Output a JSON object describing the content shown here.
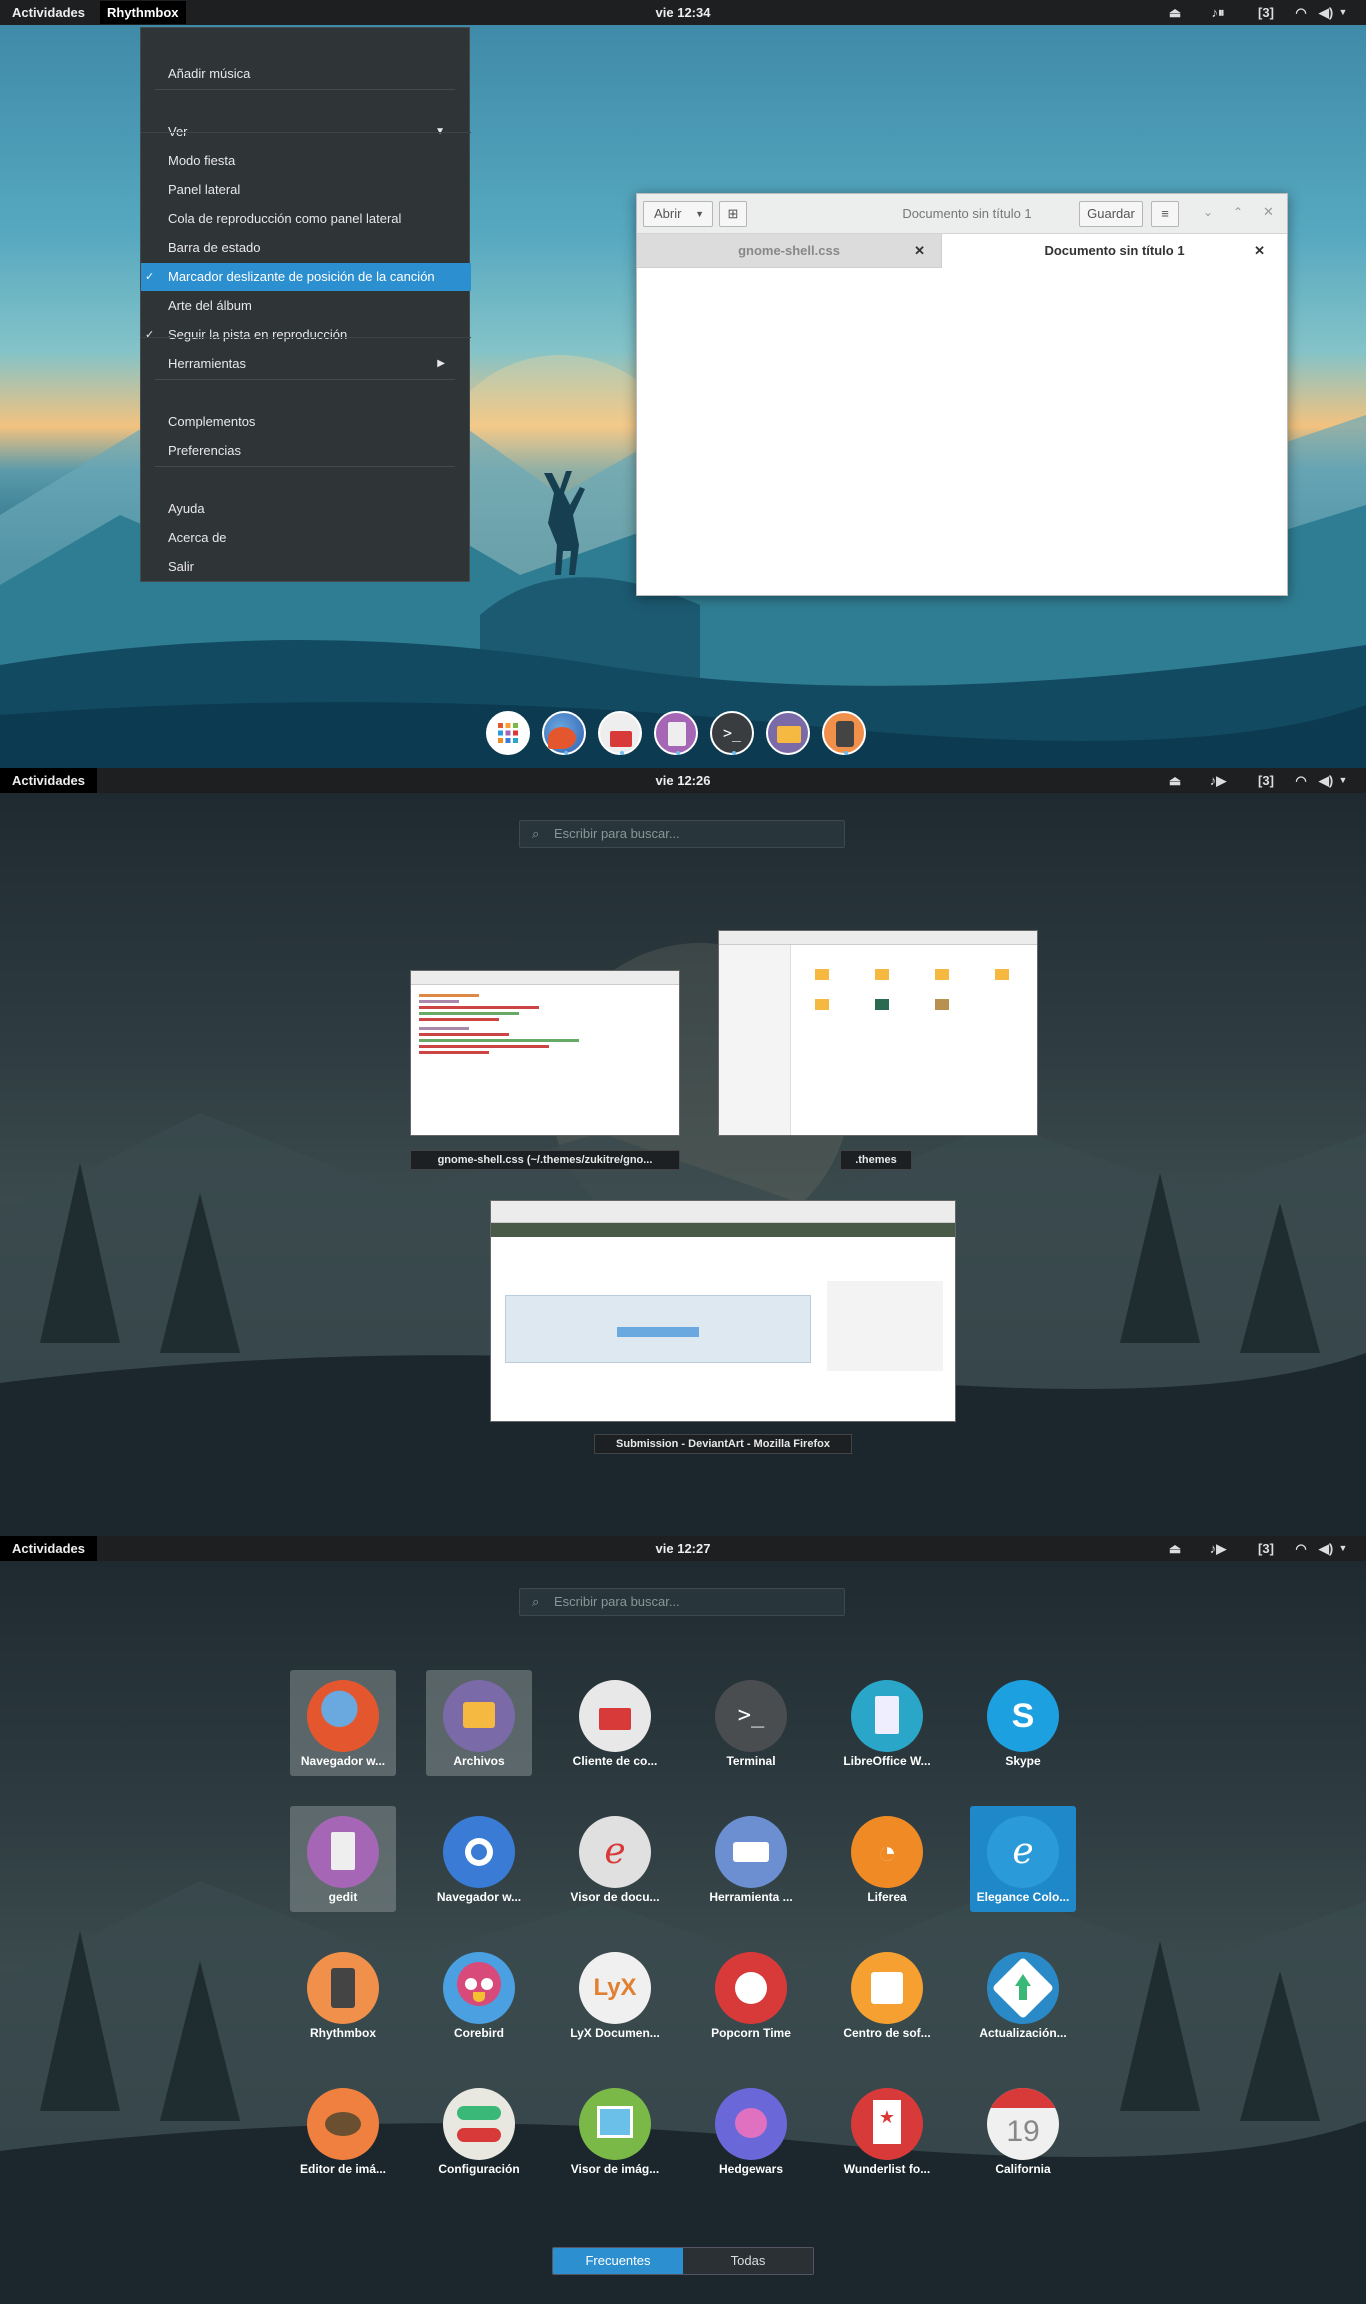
{
  "screen1": {
    "topbar": {
      "activities": "Actividades",
      "app_menu": "Rhythmbox",
      "clock": "vie 12:34",
      "workspace": "[3]"
    },
    "menu": {
      "items": [
        {
          "label": "Añadir música"
        },
        {
          "label": "Ver"
        },
        {
          "label": "Modo fiesta"
        },
        {
          "label": "Panel lateral"
        },
        {
          "label": "Cola de reproducción como panel lateral"
        },
        {
          "label": "Barra de estado"
        },
        {
          "label": "Marcador deslizante de posición de la canción",
          "checked": true,
          "selected": true
        },
        {
          "label": "Arte del álbum"
        },
        {
          "label": "Seguir la pista en reproducción",
          "checked": true
        },
        {
          "label": "Herramientas"
        },
        {
          "label": "Complementos"
        },
        {
          "label": "Preferencias"
        },
        {
          "label": "Ayuda"
        },
        {
          "label": "Acerca de"
        },
        {
          "label": "Salir"
        }
      ]
    },
    "gedit": {
      "open_label": "Abrir",
      "title": "Documento sin título 1",
      "save_label": "Guardar",
      "tabs": [
        {
          "label": "gnome-shell.css"
        },
        {
          "label": "Documento sin título 1",
          "active": true
        }
      ]
    },
    "dock": {
      "apps": [
        "Aplicaciones",
        "Firefox",
        "Correo",
        "gedit",
        "Terminal",
        "Archivos",
        "Rhythmbox"
      ]
    }
  },
  "screen2": {
    "topbar": {
      "activities": "Actividades",
      "clock": "vie 12:26",
      "workspace": "[3]"
    },
    "search_placeholder": "Escribir para buscar...",
    "windows": [
      {
        "caption": "gnome-shell.css (~/.themes/zukitre/gno..."
      },
      {
        "caption": ".themes"
      },
      {
        "caption": "Submission - DeviantArt - Mozilla Firefox"
      }
    ]
  },
  "screen3": {
    "topbar": {
      "activities": "Actividades",
      "clock": "vie 12:27",
      "workspace": "[3]"
    },
    "search_placeholder": "Escribir para buscar...",
    "apps": [
      {
        "label": "Navegador w...",
        "color": "#e4572e"
      },
      {
        "label": "Archivos",
        "color": "#7a6aa8"
      },
      {
        "label": "Cliente de co...",
        "color": "#e8e8e8"
      },
      {
        "label": "Terminal",
        "color": "#4a4d50"
      },
      {
        "label": "LibreOffice W...",
        "color": "#2aa6c8"
      },
      {
        "label": "Skype",
        "color": "#1ca0e0"
      },
      {
        "label": "gedit",
        "color": "#a566b5"
      },
      {
        "label": "Navegador w...",
        "color": "#3a7bd5"
      },
      {
        "label": "Visor de docu...",
        "color": "#e0e0e0"
      },
      {
        "label": "Herramienta ...",
        "color": "#6b8fd0"
      },
      {
        "label": "Liferea",
        "color": "#f08a24"
      },
      {
        "label": "Elegance Colo...",
        "color": "#2a9ad8"
      },
      {
        "label": "Rhythmbox",
        "color": "#f0904a"
      },
      {
        "label": "Corebird",
        "color": "#4aa0e0"
      },
      {
        "label": "LyX Documen...",
        "color": "#f0f0f0"
      },
      {
        "label": "Popcorn Time",
        "color": "#d83a3a"
      },
      {
        "label": "Centro de sof...",
        "color": "#f5a030"
      },
      {
        "label": "Actualización...",
        "color": "#2a8ac8"
      },
      {
        "label": "Editor de imá...",
        "color": "#f08040"
      },
      {
        "label": "Configuración",
        "color": "#e8e8e0"
      },
      {
        "label": "Visor de imág...",
        "color": "#7ab848"
      },
      {
        "label": "Hedgewars",
        "color": "#6a68d8"
      },
      {
        "label": "Wunderlist fo...",
        "color": "#d83a3a"
      },
      {
        "label": "California",
        "color": "#f0f0f0"
      }
    ],
    "calendar_day": "19",
    "switch": {
      "frequent": "Frecuentes",
      "all": "Todas"
    }
  },
  "colors": {
    "accent": "#2c8fd0",
    "panel": "#1d1f21",
    "menu_bg": "#2f3437"
  }
}
